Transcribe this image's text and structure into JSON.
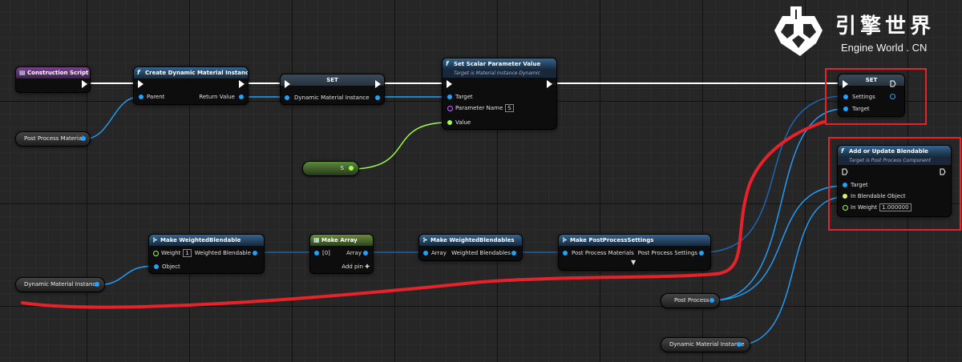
{
  "colors": {
    "background": "#262626",
    "exec_wire": "#ffffff",
    "object_wire": "#1fa3ff",
    "float_wire": "#9fff4a",
    "struct_wire": "#1b63a8",
    "annotation": "#e8222a"
  },
  "logo": {
    "chinese": "引擎世界",
    "english": "Engine World . CN"
  },
  "nodes": {
    "construction_script": {
      "title": "Construction Script",
      "icon": "event-icon"
    },
    "create_dmi": {
      "title": "Create Dynamic Material Instance",
      "icon": "function-icon",
      "in_parent": "Parent",
      "out_return": "Return Value"
    },
    "set_dmi": {
      "title": "SET",
      "in_var": "Dynamic Material Instance"
    },
    "set_scalar": {
      "title": "Set Scalar Parameter Value",
      "subtitle": "Target is Material Instance Dynamic",
      "icon": "function-icon",
      "in_target": "Target",
      "in_param": "Parameter Name",
      "param_value": "S",
      "in_value": "Value"
    },
    "set_settings": {
      "title": "SET",
      "in_settings": "Settings",
      "in_target": "Target"
    },
    "add_blendable": {
      "title": "Add or Update Blendable",
      "subtitle": "Target is Post Process Component",
      "icon": "function-icon",
      "in_target": "Target",
      "in_object": "In Blendable Object",
      "in_weight": "In Weight",
      "weight_value": "1.000000"
    },
    "make_wb": {
      "title": "Make WeightedBlendable",
      "icon": "struct-icon",
      "in_weight": "Weight",
      "weight_value": "1",
      "in_object": "Object",
      "out": "Weighted Blendable"
    },
    "make_array": {
      "title": "Make Array",
      "icon": "array-icon",
      "in_0": "[0]",
      "out": "Array",
      "add_pin": "Add pin"
    },
    "make_wbs": {
      "title": "Make WeightedBlendables",
      "icon": "struct-icon",
      "in_array": "Array",
      "out": "Weighted Blendables"
    },
    "make_pps": {
      "title": "Make PostProcessSettings",
      "icon": "struct-icon",
      "in": "Post Process Materials",
      "out": "Post Process Settings"
    }
  },
  "variables": {
    "post_process_material": "Post Process Material",
    "s": "S",
    "dmi_left": "Dynamic Material Instance",
    "post_process": "Post Process",
    "dmi_right": "Dynamic Material Instance"
  }
}
